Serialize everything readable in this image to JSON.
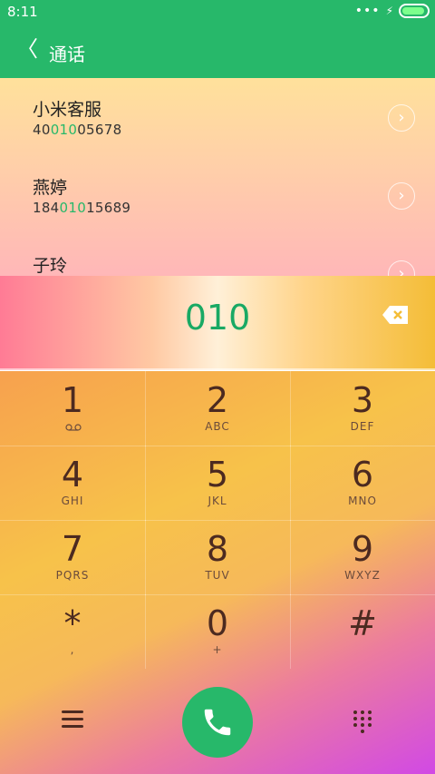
{
  "status": {
    "time": "8:11",
    "dots": "•••",
    "bolt": "⚡"
  },
  "header": {
    "back": "〈",
    "title": "通话"
  },
  "results": [
    {
      "name": "小米客服",
      "num_prefix": "40",
      "num_match": "010",
      "num_suffix": "05678"
    },
    {
      "name": "燕婷",
      "num_prefix": "184",
      "num_match": "010",
      "num_suffix": "15689"
    },
    {
      "name": "子玲",
      "num_prefix": "",
      "num_match": "",
      "num_suffix": ""
    }
  ],
  "input": {
    "value": "010"
  },
  "keys": [
    {
      "digit": "1",
      "letters": ""
    },
    {
      "digit": "2",
      "letters": "ABC"
    },
    {
      "digit": "3",
      "letters": "DEF"
    },
    {
      "digit": "4",
      "letters": "GHI"
    },
    {
      "digit": "5",
      "letters": "JKL"
    },
    {
      "digit": "6",
      "letters": "MNO"
    },
    {
      "digit": "7",
      "letters": "PQRS"
    },
    {
      "digit": "8",
      "letters": "TUV"
    },
    {
      "digit": "9",
      "letters": "WXYZ"
    },
    {
      "digit": "*",
      "letters": ","
    },
    {
      "digit": "0",
      "letters": "+"
    },
    {
      "digit": "#",
      "letters": ""
    }
  ],
  "icons": {
    "back": "chevron-left-icon",
    "row": "chevron-right-icon",
    "delete": "backspace-icon",
    "voicemail": "voicemail-icon",
    "menu": "menu-icon",
    "call": "phone-icon",
    "keypad": "keypad-icon"
  },
  "colors": {
    "accent": "#27b86a"
  }
}
